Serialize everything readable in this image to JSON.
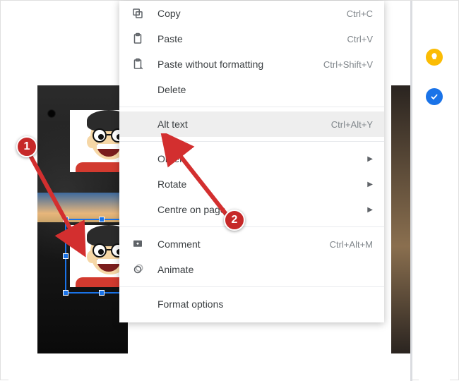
{
  "menu": {
    "copy": {
      "label": "Copy",
      "shortcut": "Ctrl+C"
    },
    "paste": {
      "label": "Paste",
      "shortcut": "Ctrl+V"
    },
    "paste_plain": {
      "label": "Paste without formatting",
      "shortcut": "Ctrl+Shift+V"
    },
    "delete": {
      "label": "Delete"
    },
    "alt_text": {
      "label": "Alt text",
      "shortcut": "Ctrl+Alt+Y"
    },
    "order": {
      "label": "Order"
    },
    "rotate": {
      "label": "Rotate"
    },
    "centre": {
      "label": "Centre on page"
    },
    "comment": {
      "label": "Comment",
      "shortcut": "Ctrl+Alt+M"
    },
    "animate": {
      "label": "Animate"
    },
    "format_options": {
      "label": "Format options"
    }
  },
  "callouts": {
    "one": "1",
    "two": "2"
  }
}
